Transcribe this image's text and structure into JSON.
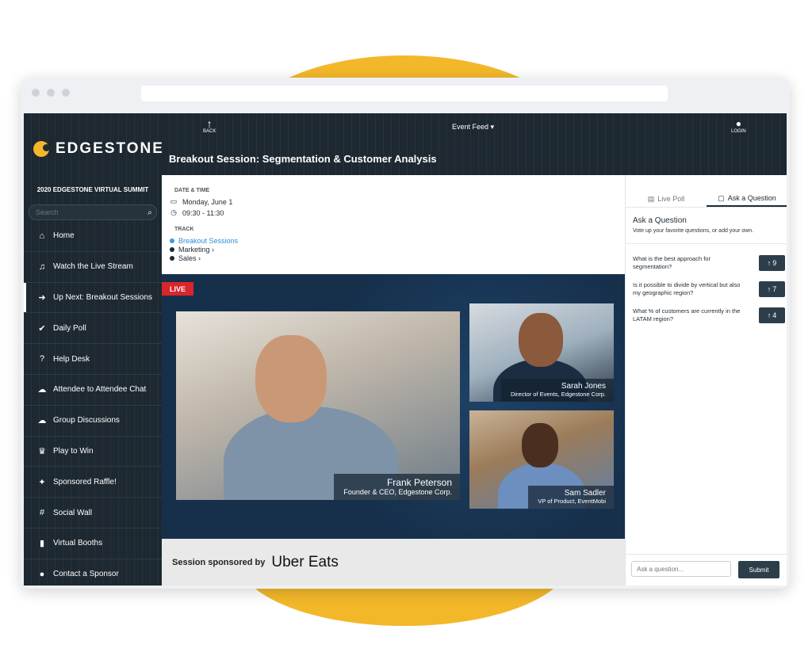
{
  "app": {
    "name": "EDGESTONE",
    "summit": "2020 EDGESTONE VIRTUAL SUMMIT"
  },
  "sidebar": {
    "search_placeholder": "Search",
    "items": [
      {
        "label": "Home",
        "icon": "home-icon",
        "glyph": "⌂"
      },
      {
        "label": "Watch the Live Stream",
        "icon": "headphones-icon",
        "glyph": "♫"
      },
      {
        "label": "Up Next: Breakout Sessions",
        "icon": "arrow-right-icon",
        "glyph": "➜"
      },
      {
        "label": "Daily Poll",
        "icon": "check-circle-icon",
        "glyph": "✔"
      },
      {
        "label": "Help Desk",
        "icon": "question-icon",
        "glyph": "?"
      },
      {
        "label": "Attendee to Attendee Chat",
        "icon": "chat-icon",
        "glyph": "☁"
      },
      {
        "label": "Group Discussions",
        "icon": "discussion-icon",
        "glyph": "☁"
      },
      {
        "label": "Play to Win",
        "icon": "trophy-icon",
        "glyph": "♛"
      },
      {
        "label": "Sponsored Raffle!",
        "icon": "magic-wand-icon",
        "glyph": "✦"
      },
      {
        "label": "Social Wall",
        "icon": "hashtag-icon",
        "glyph": "#"
      },
      {
        "label": "Virtual Booths",
        "icon": "bookmark-icon",
        "glyph": "▮"
      },
      {
        "label": "Contact a Sponsor",
        "icon": "user-icon",
        "glyph": "●"
      }
    ]
  },
  "header": {
    "back_label": "BACK",
    "event_feed": "Event Feed ▾",
    "login_label": "LOGIN",
    "session_title": "Breakout Session: Segmentation & Customer Analysis"
  },
  "info": {
    "date_label": "DATE & TIME",
    "date": "Monday, June 1",
    "time": "09:30 - 11:30",
    "track_label": "TRACK",
    "tracks": [
      "Breakout Sessions",
      "Marketing ›",
      "Sales ›"
    ]
  },
  "video": {
    "live_badge": "LIVE",
    "speakers": [
      {
        "name": "Frank Peterson",
        "role": "Founder & CEO, Edgestone Corp."
      },
      {
        "name": "Sarah Jones",
        "role": "Director of Events, Edgestone Corp."
      },
      {
        "name": "Sam Sadler",
        "role": "VP of Product, EventMobi"
      }
    ]
  },
  "sponsor": {
    "text": "Session sponsored by",
    "logo": "Uber Eats"
  },
  "panel": {
    "tabs": [
      "Live Poll",
      "Ask a Question"
    ],
    "ask_title": "Ask a Question",
    "ask_sub": "Vote up your favorite questions, or add your own.",
    "questions": [
      {
        "text": "What is the best approach for segmentation?",
        "votes": "9"
      },
      {
        "text": "Is it possible to divide by vertical but also my geographic region?",
        "votes": "7"
      },
      {
        "text": "What % of customers are currently in the LATAM region?",
        "votes": "4"
      }
    ],
    "input_placeholder": "Ask a question...",
    "submit_label": "Submit"
  }
}
